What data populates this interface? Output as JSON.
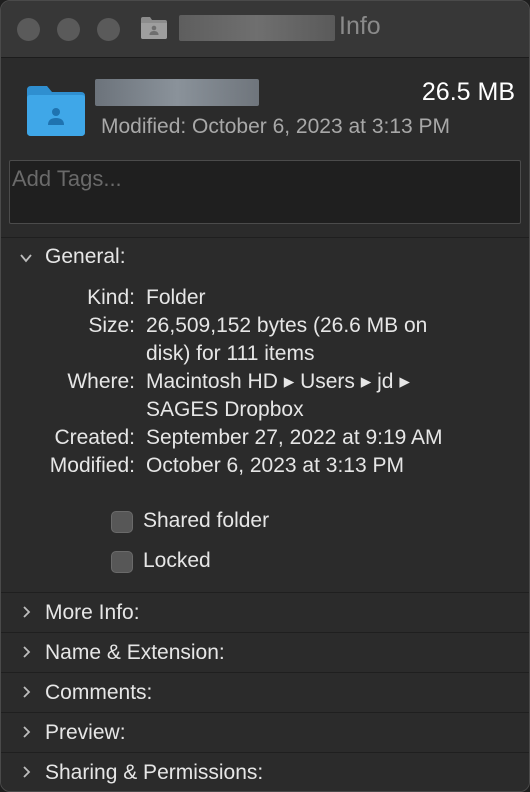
{
  "window": {
    "title_suffix": "Info"
  },
  "header": {
    "size": "26.5 MB",
    "modified": "Modified: October 6, 2023 at 3:13 PM",
    "tags_placeholder": "Add Tags..."
  },
  "general": {
    "label": "General:",
    "rows": [
      {
        "key": "Kind:",
        "value": "Folder"
      },
      {
        "key": "Size:",
        "value_line1": "26,509,152 bytes (26.6 MB on",
        "value_line2": "disk) for 111 items"
      },
      {
        "key": "Where:",
        "value_line1": "Macintosh HD ▸ Users ▸ jd ▸",
        "value_line2": "SAGES Dropbox"
      },
      {
        "key": "Created:",
        "value": "September 27, 2022 at 9:19 AM"
      },
      {
        "key": "Modified:",
        "value": "October 6, 2023 at 3:13 PM"
      }
    ],
    "shared_folder_label": "Shared folder",
    "shared_folder_checked": false,
    "locked_label": "Locked",
    "locked_checked": false
  },
  "sections": [
    {
      "label": "More Info:"
    },
    {
      "label": "Name & Extension:"
    },
    {
      "label": "Comments:"
    },
    {
      "label": "Preview:"
    },
    {
      "label": "Sharing & Permissions:"
    }
  ],
  "colors": {
    "folder_blue": "#3fa7e8",
    "background": "#2b2b2b"
  }
}
